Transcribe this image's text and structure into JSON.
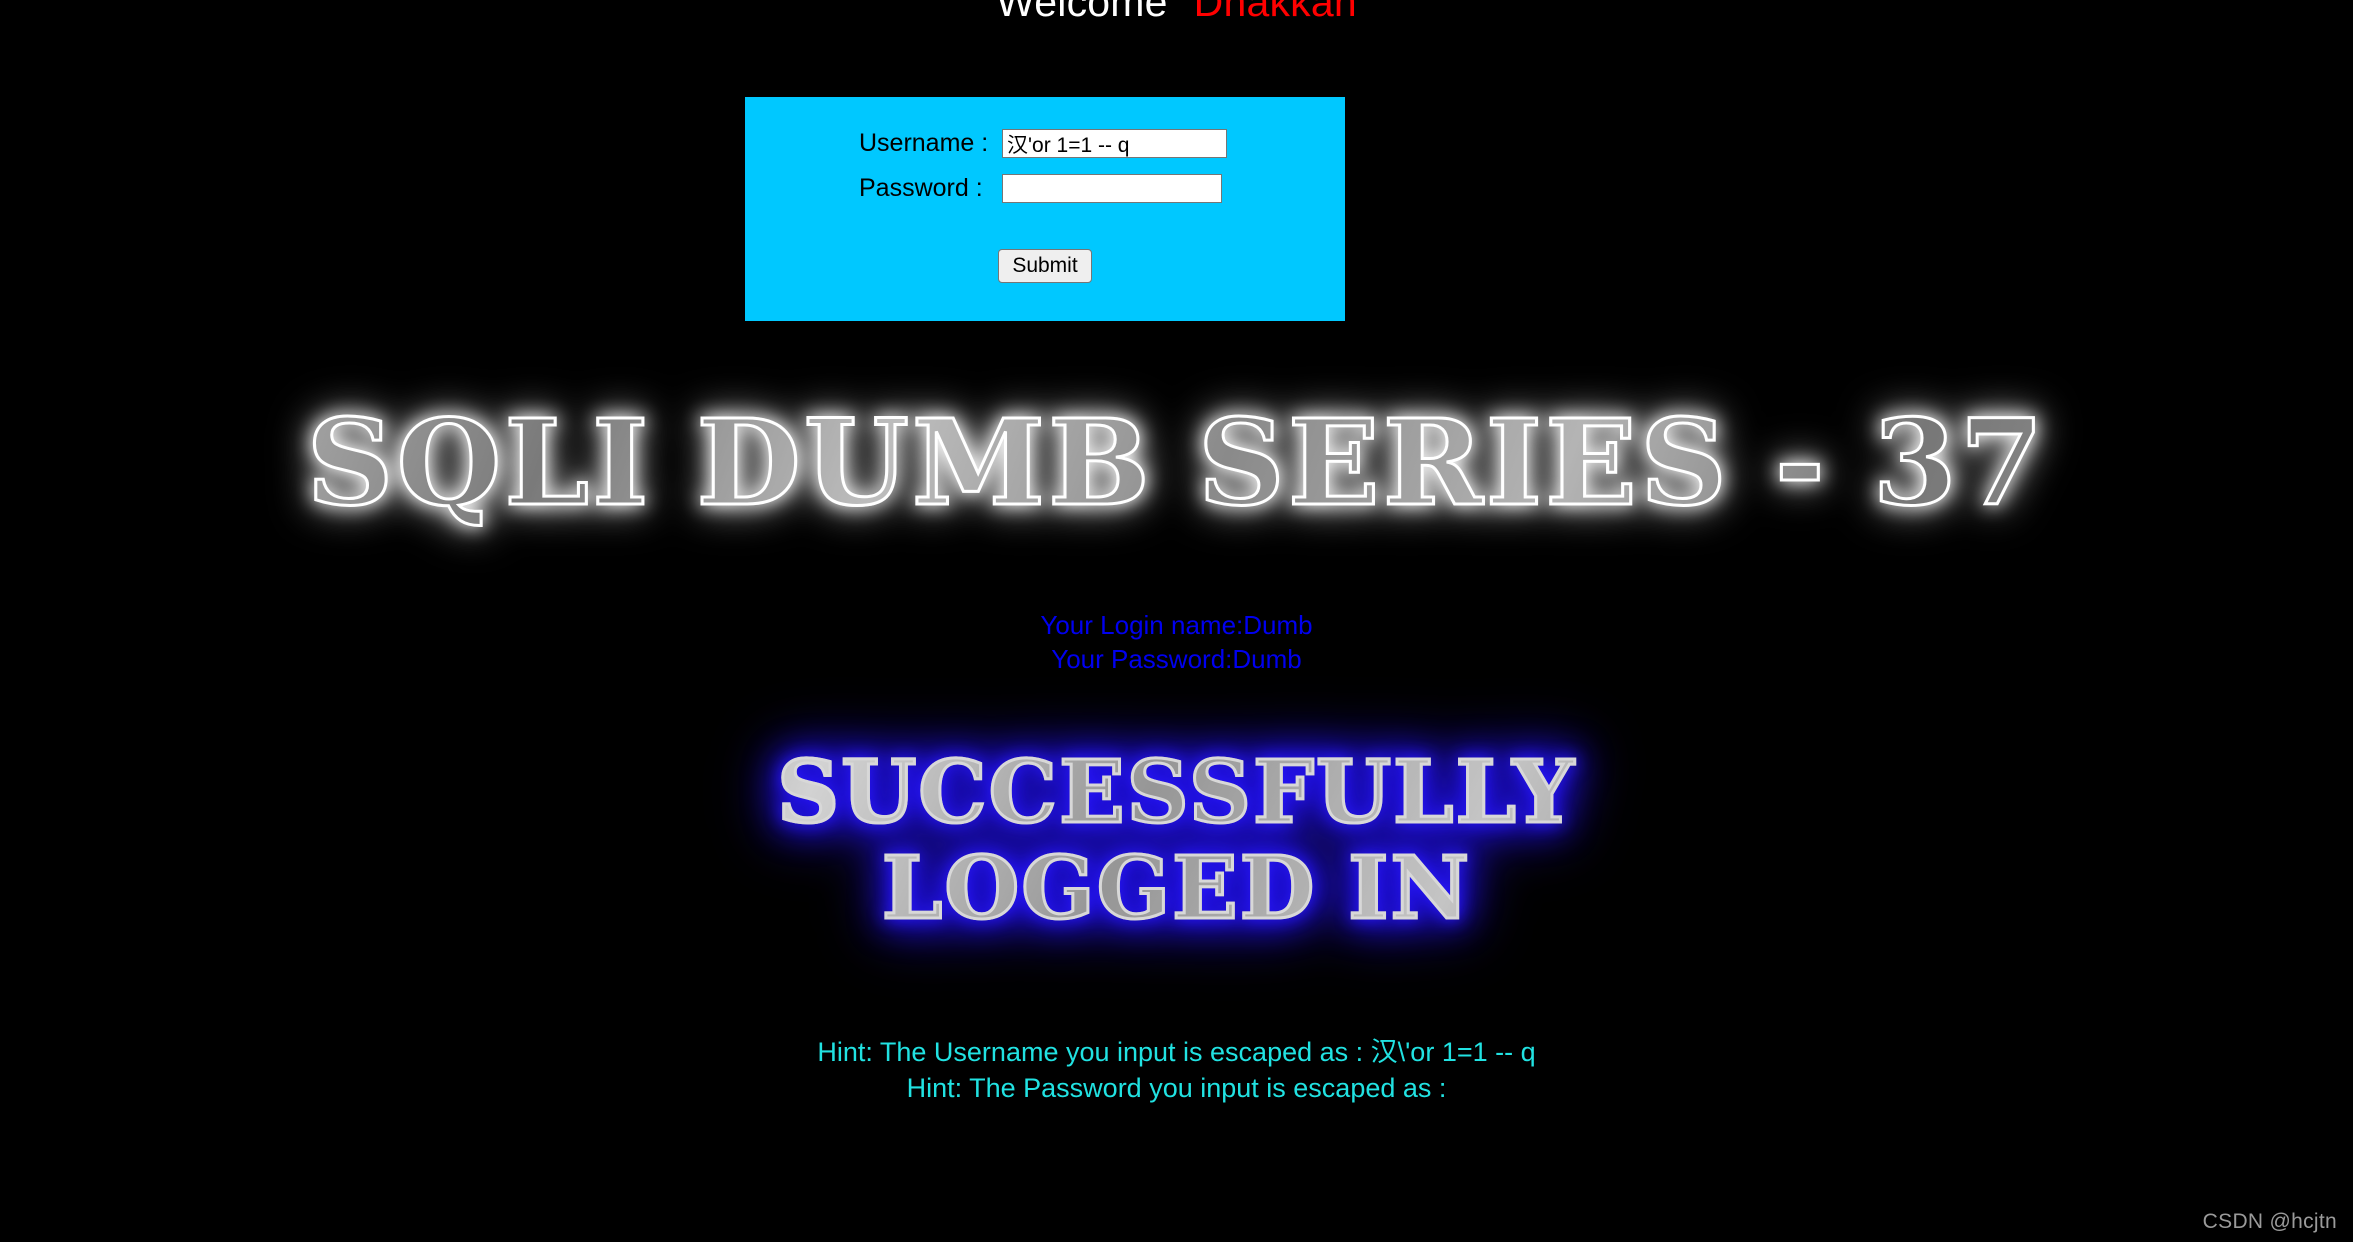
{
  "page": {
    "background_color": "#000000",
    "watermark": "CSDN @hcjtn"
  },
  "header": {
    "welcome_text": "Welcome",
    "brand_text": "Dhakkan",
    "welcome_color": "#ffffff",
    "brand_color": "#ff0000"
  },
  "login_panel": {
    "background_color": "#00c8ff",
    "username_label": "Username :",
    "password_label": "Password :",
    "username_value": "汉'or 1=1 -- q",
    "password_value": "",
    "username_placeholder": "",
    "password_placeholder": "",
    "submit_label": "Submit"
  },
  "series_title": {
    "text": "SQLI DUMB SERIES - 37",
    "glow_color": "#ffffff"
  },
  "login_info": {
    "color": "#0000ef",
    "lines": [
      "Your Login name:Dumb",
      "Your Password:Dumb"
    ]
  },
  "success_banner": {
    "glow_color": "#2a18ff",
    "lines": [
      "SUCCESSFULLY",
      "LOGGED IN"
    ]
  },
  "hints": {
    "color": "#21e2e2",
    "lines": [
      "Hint: The Username you input is escaped as : 汉\\'or 1=1 -- q",
      "Hint: The Password you input is escaped as : "
    ]
  }
}
